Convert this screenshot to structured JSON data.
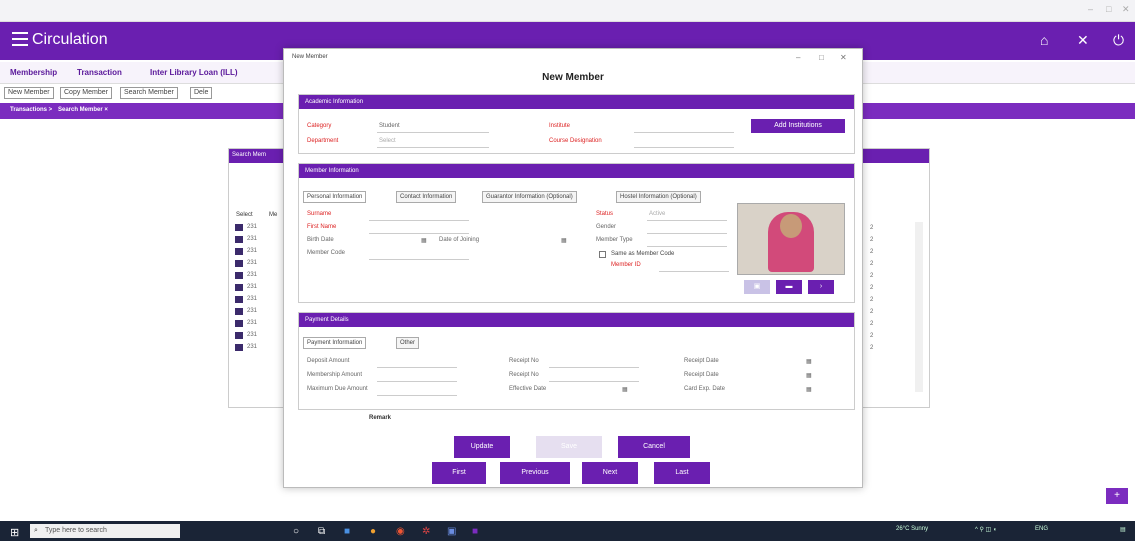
{
  "window": {
    "title": "",
    "min": "–",
    "max": "□",
    "close": "✕"
  },
  "header": {
    "title": "Circulation",
    "home_icon": "home-icon",
    "close_icon": "close-icon",
    "power_icon": "power-icon"
  },
  "menubar": {
    "items": [
      "Membership",
      "Transaction",
      "Inter Library Loan (ILL)"
    ]
  },
  "tabs": {
    "items": [
      "New Member",
      "Copy Member",
      "Search Member",
      "Dele"
    ]
  },
  "breadcrumb": {
    "items": [
      "Transactions >",
      "Search Member ×"
    ]
  },
  "grid": {
    "title": "Search Mem",
    "col_select": "Select",
    "col_me": "Me",
    "rows": [
      "231",
      "231",
      "231",
      "231",
      "231",
      "231",
      "231",
      "231",
      "231",
      "231",
      "231"
    ],
    "right_rows": [
      "2",
      "2",
      "2",
      "2",
      "2",
      "2",
      "2",
      "2",
      "2",
      "2",
      "2"
    ]
  },
  "modal": {
    "window_title": "New Member",
    "heading": "New Member",
    "academic": {
      "title": "Academic Information",
      "category_label": "Category",
      "category_value": "Student",
      "department_label": "Department",
      "department_value": "Select",
      "institute_label": "Institute",
      "institute_value": "",
      "course_label": "Course Designation",
      "course_value": "",
      "add_button": "Add Institutions"
    },
    "member": {
      "title": "Member Information",
      "tabs": [
        "Personal Information",
        "Contact Information",
        "Guarantor Information (Optional)",
        "Hostel Information (Optional)"
      ],
      "surname_label": "Surname",
      "firstname_label": "First Name",
      "birthdate_label": "Birth Date",
      "birthdate_value": "",
      "joining_label": "Date of Joining",
      "joining_value": "",
      "membercode_label": "Member Code",
      "path_value": "",
      "status_label": "Status",
      "status_value": "Active",
      "gender_label": "Gender",
      "gender_value": "",
      "membertype_label": "Member Type",
      "membertype_value": "",
      "same_as_code": "Same as Member Code",
      "member_id_label": "Member ID"
    },
    "payment": {
      "title": "Payment Details",
      "tabs": [
        "Payment Information",
        "Other"
      ],
      "deposit_label": "Deposit Amount",
      "deposit_value": "",
      "membership_label": "Membership Amount",
      "membership_value": "",
      "maxdue_label": "Maximum Due Amount",
      "maxdue_value": "",
      "receipt_no1_label": "Receipt No",
      "receipt_no2_label": "Receipt No",
      "effective_label": "Effective Date",
      "effective_value": "",
      "receipt_date1_label": "Receipt Date",
      "receipt_date1_value": "",
      "receipt_date2_label": "Receipt Date",
      "receipt_date2_value": "",
      "card_exp_label": "Card Exp. Date",
      "card_exp_value": ""
    },
    "remark_label": "Remark",
    "buttons": {
      "update": "Update",
      "save": "Save",
      "cancel": "Cancel",
      "first": "First",
      "previous": "Previous",
      "next": "Next",
      "last": "Last"
    }
  },
  "taskbar": {
    "search_placeholder": "Type here to search",
    "weather": "26°C Sunny",
    "lang": "ENG",
    "time": "",
    "date": ""
  },
  "colors": {
    "accent": "#6a1fb0",
    "taskbar": "#1a2436"
  }
}
